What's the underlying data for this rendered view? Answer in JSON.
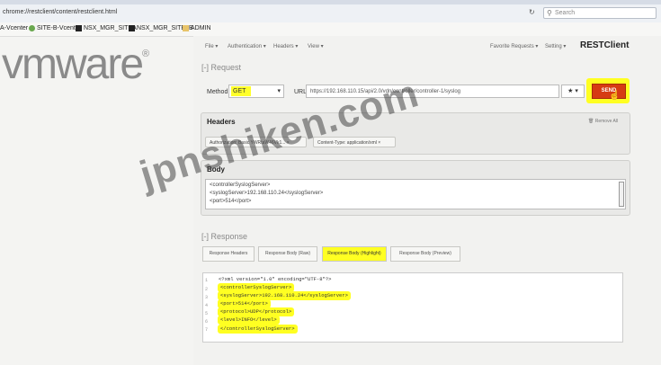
{
  "browser": {
    "url": "chrome://restclient/content/restclient.html",
    "search_placeholder": "Search",
    "reload_icon": "reload-icon",
    "bookmarks": [
      {
        "label": "A-Vcenter",
        "color": "#4a7dbf"
      },
      {
        "label": "SITE-B-Vcenter",
        "color": "#6aa84f"
      },
      {
        "label": "NSX_MGR_SITEA",
        "color": "#222222"
      },
      {
        "label": "NSX_MGR_SITE_B",
        "color": "#222222"
      },
      {
        "label": "ADMIN",
        "color": "#e8c46a"
      }
    ]
  },
  "logo": {
    "text": "vmware",
    "mark": "®"
  },
  "app": {
    "name": "RESTClient",
    "menu": [
      "File",
      "Authentication",
      "Headers",
      "View"
    ],
    "menu_right": [
      "Favorite Requests",
      "Setting"
    ]
  },
  "request": {
    "title": "[-] Request",
    "method_label": "Method",
    "method": "GET",
    "url_label": "URL",
    "url": "https://192.168.110.15/api/2.0/vdn/controller/controller-1/syslog",
    "fav_icon": "star-icon",
    "send": "SEND"
  },
  "headers": {
    "title": "Headers",
    "remove_all": "Remove All",
    "items": [
      {
        "label": "Authorization: Basic YWRtaW46Vk1..."
      },
      {
        "label": "Content-Type: application/xml"
      }
    ]
  },
  "body": {
    "title": "Body",
    "lines": [
      "<controllerSyslogServer>",
      "  <syslogServer>192.168.110.24</syslogServer>",
      "  <port>514</port>"
    ]
  },
  "response": {
    "title": "[-] Response",
    "tabs": [
      "Response Headers",
      "Response Body (Raw)",
      "Response Body (Highlight)",
      "Response Body (Preview)"
    ],
    "active_tab": 2,
    "lines": [
      "<?xml version=\"1.0\" encoding=\"UTF-8\"?>",
      "<controllerSyslogServer>",
      "<syslogServer>192.168.110.24</syslogServer>",
      "<port>514</port>",
      "<protocol>UDP</protocol>",
      "<level>INFO</level>",
      "</controllerSyslogServer>"
    ],
    "line_numbers": [
      "1",
      "2",
      "3",
      "4",
      "5",
      "6",
      "7"
    ]
  },
  "watermark": "jpnshiken.com",
  "highlight_color": "#ffff22",
  "send_color": "#d63b13"
}
